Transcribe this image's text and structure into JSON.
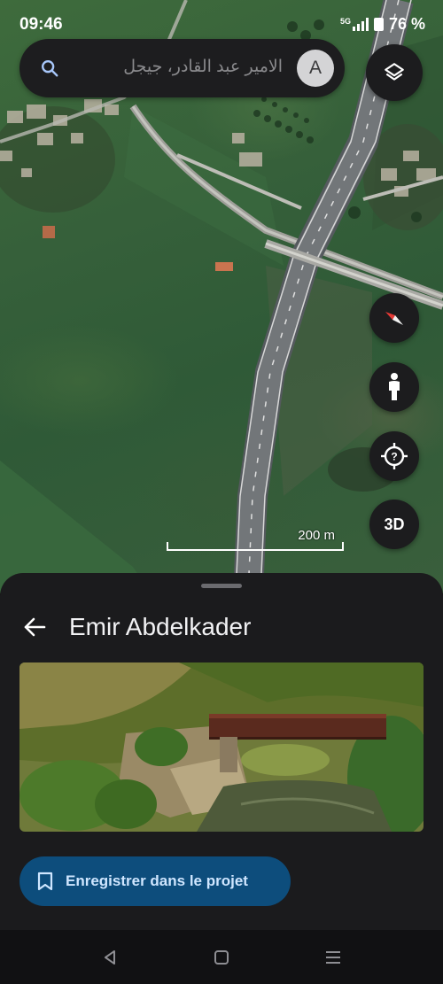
{
  "status_bar": {
    "time": "09:46",
    "network": "5G",
    "battery": "76 %"
  },
  "search": {
    "query": "الامير عبد القادر، جيجل",
    "avatar_initial": "A"
  },
  "map_controls": {
    "layers_icon": "layers-icon",
    "compass_icon": "compass-icon",
    "pegman_icon": "pegman-icon",
    "location_icon": "my-location-icon",
    "threed_label": "3D"
  },
  "scale": {
    "label": "200 m"
  },
  "place_sheet": {
    "title": "Emir Abdelkader",
    "save_label": "Enregistrer dans le projet"
  },
  "colors": {
    "sheet_background": "#1b1b1d",
    "save_button": "#0d4d7c",
    "save_text": "#cfe6ff",
    "control_background": "#1c1c1e",
    "compass_red": "#e53935"
  }
}
